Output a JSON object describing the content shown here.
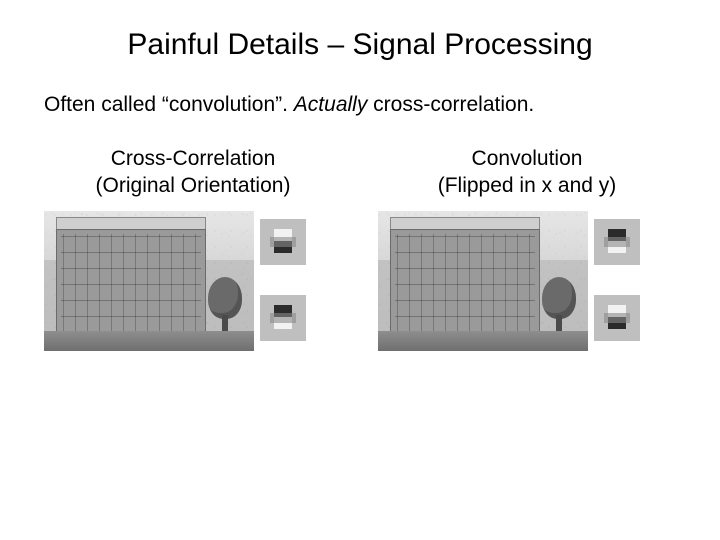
{
  "title": "Painful Details – Signal Processing",
  "subtitle_part1": "Often called “convolution”. ",
  "subtitle_part2": "Actually",
  "subtitle_part3": " cross-correlation.",
  "left": {
    "heading_line1": "Cross-Correlation",
    "heading_line2": "(Original Orientation)"
  },
  "right": {
    "heading_line1": "Convolution",
    "heading_line2": "(Flipped in x and y)"
  },
  "figures": {
    "building_alt": "grayscale photograph of a multi-story building facade with a tree in foreground (placeholder rendering)",
    "cc_kernel1_alt": "Sobel-like horizontal gradient kernel, light top / dark bottom",
    "cc_kernel2_alt": "Sobel-like horizontal gradient kernel, dark top / light bottom",
    "conv_kernel1_alt": "Flipped kernel, dark top / light bottom",
    "conv_kernel2_alt": "Flipped kernel, light top / dark bottom"
  }
}
